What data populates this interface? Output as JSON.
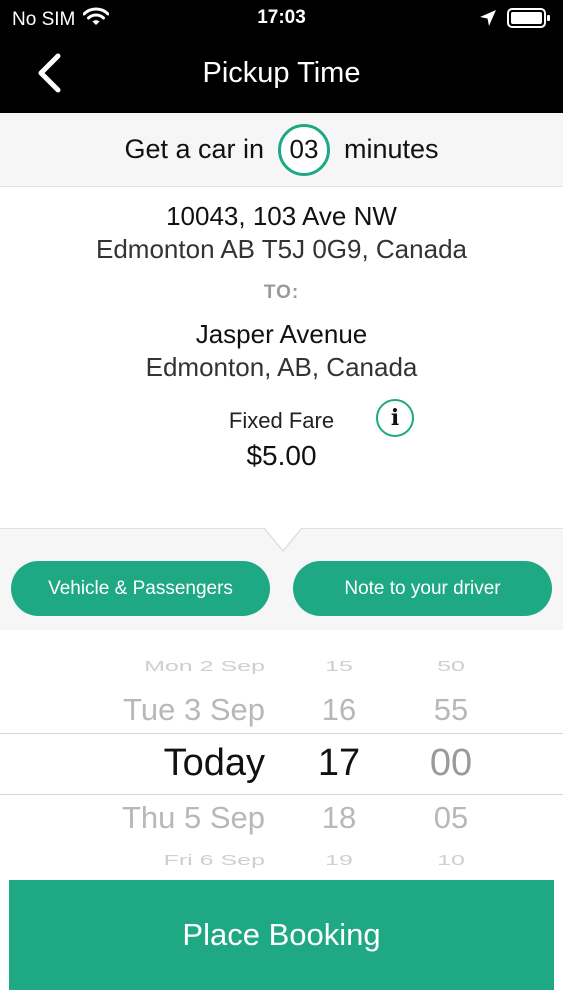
{
  "status_bar": {
    "carrier": "No SIM",
    "time": "17:03"
  },
  "nav": {
    "title": "Pickup Time"
  },
  "eta": {
    "prefix": "Get a car in",
    "minutes": "03",
    "suffix": "minutes"
  },
  "pickup": {
    "line1": "10043, 103 Ave NW",
    "line2": "Edmonton AB T5J 0G9, Canada"
  },
  "to_label": "TO:",
  "destination": {
    "line1": "Jasper Avenue",
    "line2": "Edmonton, AB, Canada"
  },
  "fare": {
    "label": "Fixed Fare",
    "value": "$5.00",
    "info_glyph": "i"
  },
  "options": {
    "vehicle_label": "Vehicle & Passengers",
    "note_label": "Note to your driver"
  },
  "picker": {
    "days": [
      "Mon 2 Sep",
      "Tue 3 Sep",
      "Today",
      "Thu 5 Sep",
      "Fri 6 Sep"
    ],
    "hours": [
      "15",
      "16",
      "17",
      "18",
      "19"
    ],
    "minutes": [
      "50",
      "55",
      "00",
      "05",
      "10"
    ]
  },
  "booking": {
    "label": "Place Booking"
  },
  "colors": {
    "accent": "#1ea883",
    "bar": "#000000",
    "panel": "#f6f6f7"
  },
  "icons": [
    "wifi-icon",
    "location-arrow-icon",
    "battery-icon",
    "back-chevron-icon",
    "info-icon"
  ]
}
